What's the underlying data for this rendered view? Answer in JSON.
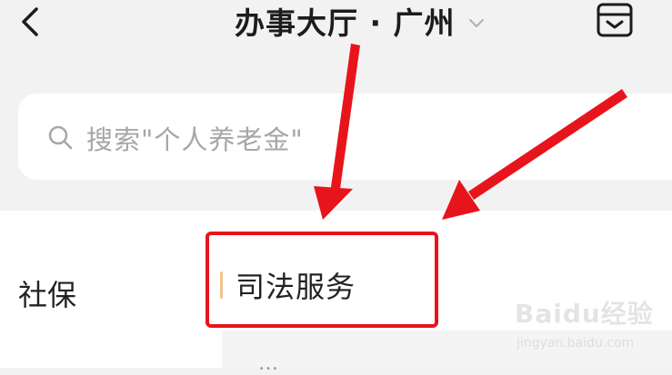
{
  "header": {
    "title": "办事大厅 · 广州",
    "icons": {
      "back": "chevron-left-icon",
      "city_dropdown": "chevron-down-icon",
      "right": "inbox-box-icon"
    }
  },
  "search": {
    "placeholder": "搜索\"个人养老金\"",
    "icon": "search-icon"
  },
  "sidebar": {
    "items": [
      {
        "label": "社保"
      }
    ]
  },
  "content": {
    "section_label": "司法服务",
    "sub_partial": "…"
  },
  "annotation": {
    "highlight_color": "#e8141c",
    "arrow_color": "#e8141c"
  },
  "watermark": {
    "main": "Baidu经验",
    "sub": "jingyan.baidu.com"
  },
  "colors": {
    "background": "#f2f2f2",
    "section_accent": "#f0c48f"
  }
}
